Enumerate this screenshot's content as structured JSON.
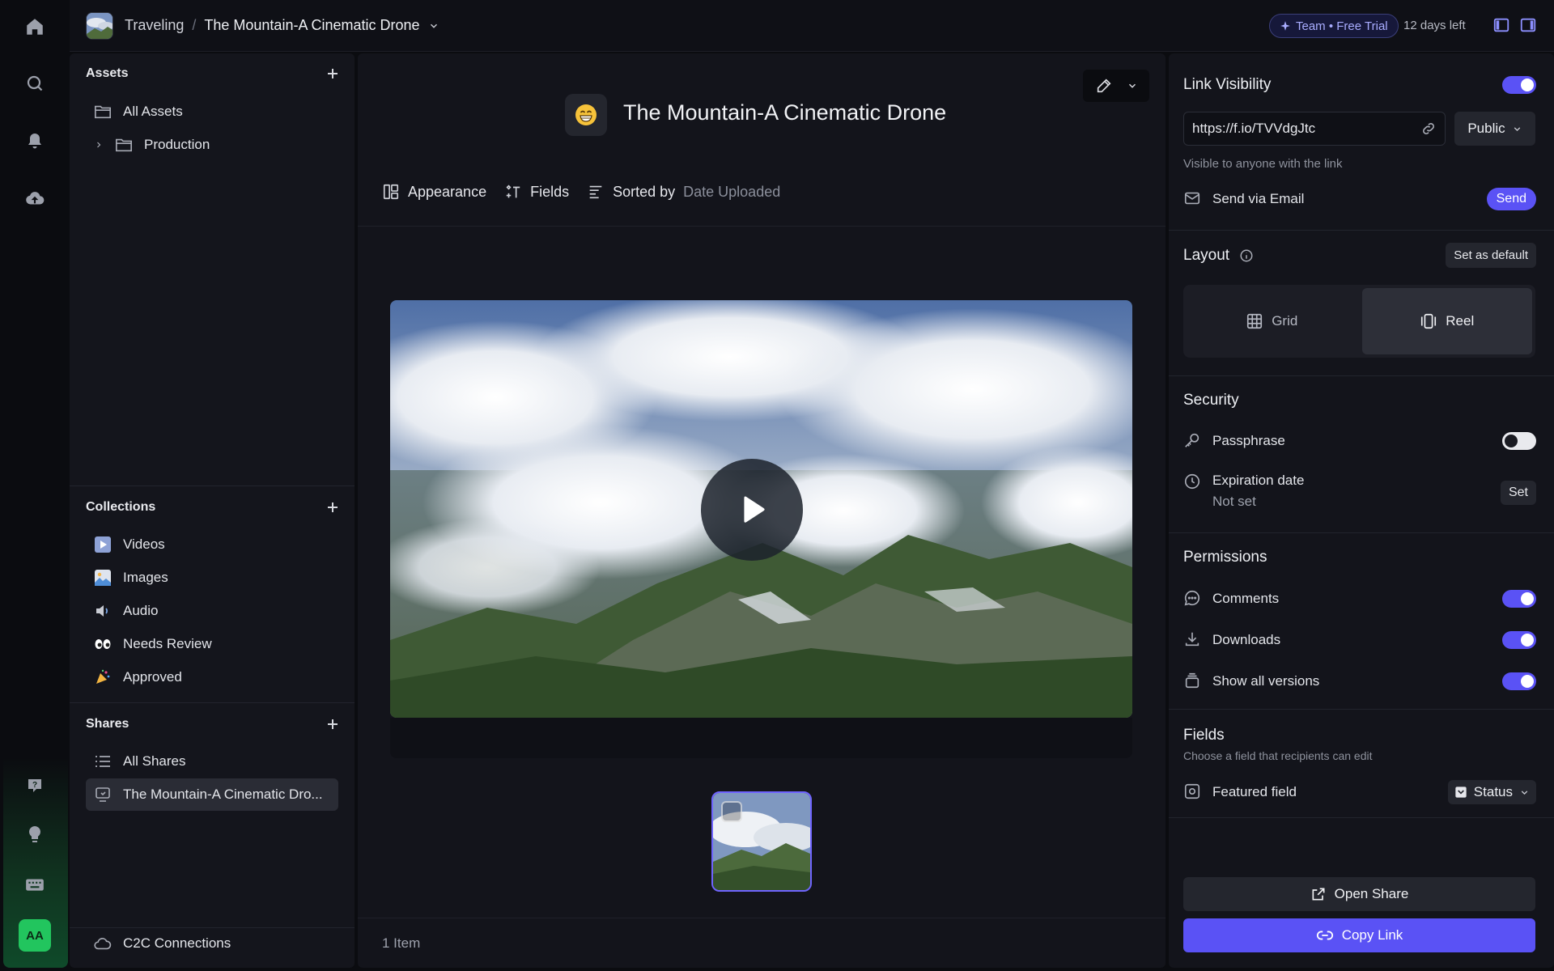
{
  "header": {
    "breadcrumb_project": "Traveling",
    "breadcrumb_separator": "/",
    "breadcrumb_current": "The Mountain-A Cinematic Drone",
    "trial_badge": "Team • Free Trial",
    "days_left": "12 days left"
  },
  "rail": {
    "icons": [
      "home-icon",
      "search-icon",
      "bell-icon",
      "upload-cloud-icon",
      "help-icon",
      "lightbulb-icon",
      "keyboard-icon"
    ],
    "avatar_initials": "AA"
  },
  "sidebar": {
    "assets": {
      "title": "Assets",
      "items": [
        {
          "label": "All Assets"
        },
        {
          "label": "Production"
        }
      ]
    },
    "collections": {
      "title": "Collections",
      "items": [
        {
          "label": "Videos"
        },
        {
          "label": "Images"
        },
        {
          "label": "Audio"
        },
        {
          "label": "Needs Review"
        },
        {
          "label": "Approved"
        }
      ]
    },
    "shares": {
      "title": "Shares",
      "items": [
        {
          "label": "All Shares"
        },
        {
          "label": "The Mountain-A Cinematic Dro..."
        }
      ]
    },
    "footer": {
      "label": "C2C Connections"
    }
  },
  "main": {
    "title_emoji": "😁",
    "title": "The Mountain-A Cinematic Drone",
    "toolbar": {
      "appearance": "Appearance",
      "fields": "Fields",
      "sorted_by": "Sorted by",
      "sort_value": "Date Uploaded"
    },
    "item_count": "1 Item"
  },
  "panel": {
    "link_visibility": {
      "title": "Link Visibility",
      "enabled": true,
      "url": "https://f.io/TVVdgJtc",
      "visibility": "Public",
      "hint": "Visible to anyone with the link",
      "send_via_email": "Send via Email",
      "send_button": "Send"
    },
    "layout": {
      "title": "Layout",
      "set_default": "Set as default",
      "options": [
        "Grid",
        "Reel"
      ],
      "selected": "Reel"
    },
    "security": {
      "title": "Security",
      "passphrase": "Passphrase",
      "passphrase_enabled": false,
      "expiration": "Expiration date",
      "expiration_value": "Not set",
      "expiration_button": "Set"
    },
    "permissions": {
      "title": "Permissions",
      "comments": "Comments",
      "comments_enabled": true,
      "downloads": "Downloads",
      "downloads_enabled": true,
      "show_versions": "Show all versions",
      "show_versions_enabled": true
    },
    "fields": {
      "title": "Fields",
      "hint": "Choose a field that recipients can edit",
      "featured": "Featured field",
      "featured_value": "Status"
    },
    "open_share": "Open Share",
    "copy_link": "Copy Link"
  },
  "colors": {
    "accent": "#5a52f5",
    "background": "#0b0c10",
    "panel": "#13141b"
  }
}
